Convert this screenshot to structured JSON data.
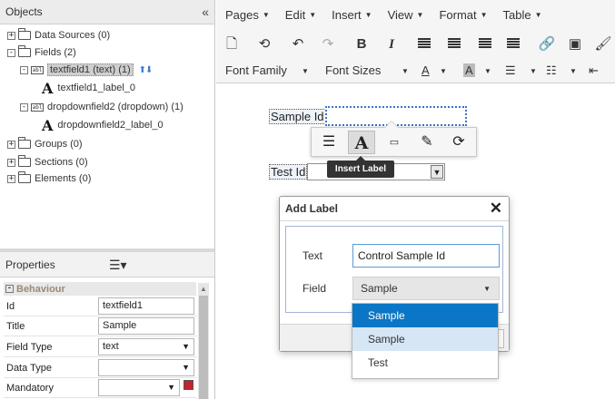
{
  "objects_panel": {
    "title": "Objects",
    "collapse_icon": "«",
    "tree": [
      {
        "label": "Data Sources (0)",
        "expander": "+"
      },
      {
        "label": "Fields (2)",
        "expander": "-"
      },
      {
        "label": "textfield1 (text) (1)",
        "expander": "-"
      },
      {
        "label": "textfield1_label_0"
      },
      {
        "label": "dropdownfield2 (dropdown) (1)",
        "expander": "-"
      },
      {
        "label": "dropdownfield2_label_0"
      },
      {
        "label": "Groups (0)",
        "expander": "+"
      },
      {
        "label": "Sections (0)",
        "expander": "+"
      },
      {
        "label": "Elements (0)",
        "expander": "+"
      }
    ],
    "move_arrows": "⬆⬇"
  },
  "properties_panel": {
    "title": "Properties",
    "list_icon": "☰▾",
    "section": "Behaviour",
    "rows": [
      {
        "key": "Id",
        "value": ""
      },
      {
        "key": "Title",
        "value": ""
      },
      {
        "key": "Field Type",
        "value": "text"
      },
      {
        "key": "Data Type",
        "value": ""
      },
      {
        "key": "Mandatory",
        "value": ""
      }
    ],
    "values": {
      "id": "textfield1",
      "title": "Sample"
    }
  },
  "menubar": {
    "items": [
      "Pages",
      "Edit",
      "Insert",
      "View",
      "Format",
      "Table"
    ]
  },
  "toolbar2": {
    "font_family": "Font Family",
    "font_sizes": "Font Sizes",
    "text_color_glyph": "A",
    "bg_color_glyph": "A"
  },
  "canvas": {
    "sample_label": "Sample Id",
    "test_label": "Test Id"
  },
  "inline_toolbar": {
    "tooltip": "Insert Label",
    "buttons": [
      "list-icon",
      "font-a-icon",
      "input-field-icon",
      "edit-icon",
      "refresh-icon"
    ]
  },
  "dialog": {
    "title": "Add Label",
    "close_glyph": "✕",
    "text_label": "Text",
    "text_value": "Control Sample Id",
    "field_label": "Field",
    "field_value": "Sample"
  },
  "dropdown_options": [
    {
      "label": "Sample",
      "state": "selected"
    },
    {
      "label": "Sample",
      "state": "hover"
    },
    {
      "label": "Test",
      "state": "normal"
    }
  ],
  "colors": {
    "selection_blue": "#0a76c5",
    "hover_blue": "#d6e6f5",
    "focus_border": "#5b9bd5",
    "mandatory_red": "#c2222b"
  }
}
